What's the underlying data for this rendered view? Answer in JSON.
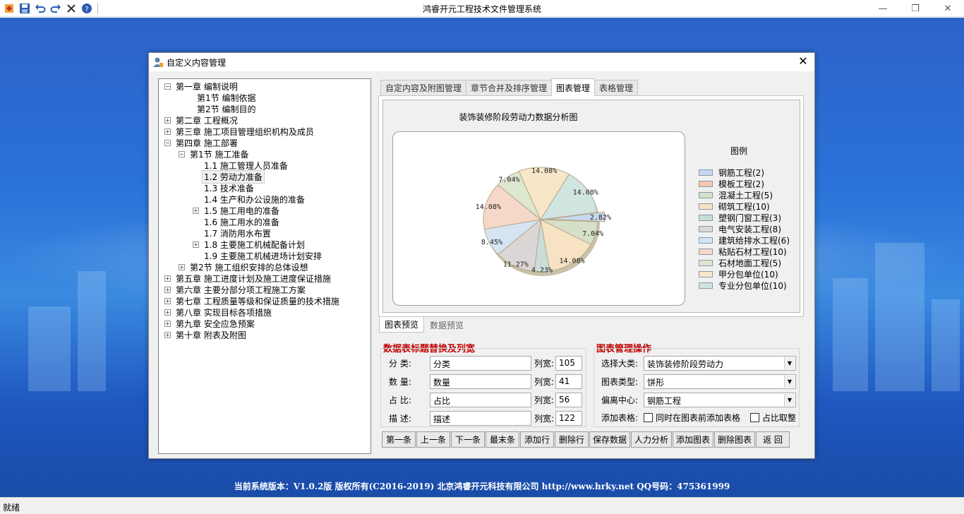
{
  "app": {
    "title": "鸿睿开元工程技术文件管理系统",
    "toolbar_icons": [
      "app-logo-icon",
      "save-icon",
      "undo-icon",
      "redo-icon",
      "close-x-icon",
      "help-icon"
    ]
  },
  "dialog": {
    "title": "自定义内容管理"
  },
  "tree": [
    {
      "label": "第一章   编制说明",
      "expanded": true
    },
    {
      "label": "第1节   编制依据"
    },
    {
      "label": "第2节   编制目的"
    },
    {
      "label": "第二章   工程概况",
      "expanded": false
    },
    {
      "label": "第三章   施工项目管理组织机构及成员",
      "expanded": false
    },
    {
      "label": "第四章   施工部署",
      "expanded": true
    },
    {
      "label": "第1节   施工准备",
      "expanded": true
    },
    {
      "label": "1.1   施工管理人员准备"
    },
    {
      "label": "1.2   劳动力准备",
      "selected": true
    },
    {
      "label": "1.3   技术准备"
    },
    {
      "label": "1.4   生产和办公设施的准备"
    },
    {
      "label": "1.5   施工用电的准备",
      "expanded": false
    },
    {
      "label": "1.6   施工用水的准备"
    },
    {
      "label": "1.7   消防用水布置"
    },
    {
      "label": "1.8   主要施工机械配备计划",
      "expanded": false
    },
    {
      "label": "1.9   主要施工机械进场计划安排"
    },
    {
      "label": "第2节   施工组织安排的总体设想",
      "expanded": false
    },
    {
      "label": "第五章   施工进度计划及施工进度保证措施",
      "expanded": false
    },
    {
      "label": "第六章   主要分部分项工程施工方案",
      "expanded": false
    },
    {
      "label": "第七章   工程质量等级和保证质量的技术措施",
      "expanded": false
    },
    {
      "label": "第八章   实现目标各项措施",
      "expanded": false
    },
    {
      "label": "第九章   安全应急预案",
      "expanded": false
    },
    {
      "label": "第十章   附表及附图",
      "expanded": false
    }
  ],
  "tabs": [
    "自定内容及附图管理",
    "章节合并及排序管理",
    "图表管理",
    "表格管理"
  ],
  "subtabs": [
    "图表预览",
    "数据预览"
  ],
  "chart_data": {
    "type": "pie",
    "title": "装饰装修阶段劳动力数据分析图",
    "legend_title": "图例",
    "categories": [
      "钢筋工程(2)",
      "模板工程(2)",
      "混凝土工程(5)",
      "砌筑工程(10)",
      "塑钢门窗工程(3)",
      "电气安装工程(8)",
      "建筑给排水工程(6)",
      "粘贴石材工程(10)",
      "石材地面工程(5)",
      "甲分包单位(10)",
      "专业分包单位(10)"
    ],
    "values": [
      2.82,
      2.82,
      7.04,
      14.08,
      4.23,
      11.27,
      8.45,
      14.08,
      7.04,
      14.08,
      14.08
    ],
    "colors": [
      "#c6d9ee",
      "#f5c8ad",
      "#d6e0c8",
      "#f7e3c4",
      "#c9ddd8",
      "#dcd6d6",
      "#d6e4f2",
      "#f6d8c8",
      "#dde6cf",
      "#f8e6c8",
      "#d0e4e0"
    ],
    "slices_clockwise_from_east": [
      {
        "legend_index": 0,
        "label": "2.82%"
      },
      {
        "legend_index": 2,
        "label": "7.04%"
      },
      {
        "legend_index": 3,
        "label": "14.08%"
      },
      {
        "legend_index": 4,
        "label": "4.23%"
      },
      {
        "legend_index": 5,
        "label": "11.27%"
      },
      {
        "legend_index": 6,
        "label": "8.45%"
      },
      {
        "legend_index": 7,
        "label": "14.08%"
      },
      {
        "legend_index": 8,
        "label": "7.04%"
      },
      {
        "legend_index": 9,
        "label": "14.08%"
      },
      {
        "legend_index": 10,
        "label": "14.08%"
      }
    ],
    "exploded_slice_label": "2.82%"
  },
  "fields_group": {
    "title": "数据表标题替换及列宽",
    "rows": [
      {
        "label": "分    类:",
        "value": "分类",
        "width_label": "列宽:",
        "width": "105"
      },
      {
        "label": "数    量:",
        "value": "数量",
        "width_label": "列宽:",
        "width": "41"
      },
      {
        "label": "占    比:",
        "value": "占比",
        "width_label": "列宽:",
        "width": "56"
      },
      {
        "label": "描    述:",
        "value": "描述",
        "width_label": "列宽:",
        "width": "122"
      }
    ]
  },
  "ops_group": {
    "title": "图表管理操作",
    "category_label": "选择大类:",
    "category_value": "装饰装修阶段劳动力",
    "chart_type_label": "图表类型:",
    "chart_type_value": "饼形",
    "offset_label": "偏离中心:",
    "offset_value": "钢筋工程",
    "add_table_label": "添加表格:",
    "add_table_option": "同时在图表前添加表格",
    "round_option": "占比取整"
  },
  "buttons": [
    "第一条",
    "上一条",
    "下一条",
    "最末条",
    "添加行",
    "删除行",
    "保存数据",
    "人力分析",
    "添加图表",
    "删除图表",
    "返 回"
  ],
  "footer": "当前系统版本：V1.0.2版   版权所有(C2016-2019)   北京鸿睿开元科技有限公司   http://www.hrky.net QQ号码：475361999",
  "status": "就绪"
}
